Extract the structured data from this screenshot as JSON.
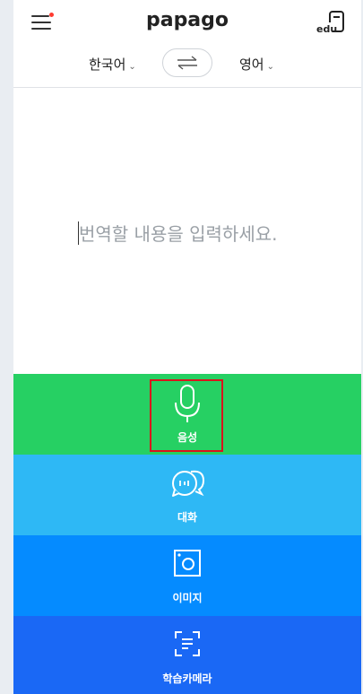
{
  "header": {
    "logo": "papago",
    "menu_icon": "hamburger-menu-icon",
    "edu_label": "edu"
  },
  "language_bar": {
    "source_language": "한국어",
    "target_language": "영어",
    "swap_icon": "swap-arrows-icon"
  },
  "input": {
    "placeholder": "번역할 내용을 입력하세요."
  },
  "features": {
    "voice": {
      "label": "음성",
      "icon": "microphone-icon",
      "color": "#26d063"
    },
    "conversation": {
      "label": "대화",
      "icon": "chat-bubbles-icon",
      "color": "#2eb8f5"
    },
    "image": {
      "label": "이미지",
      "icon": "image-frame-icon",
      "color": "#058bff"
    },
    "camera": {
      "label": "학습카메라",
      "icon": "scan-document-icon",
      "color": "#1a68f5"
    }
  },
  "accent_highlight_color": "#d9141c"
}
